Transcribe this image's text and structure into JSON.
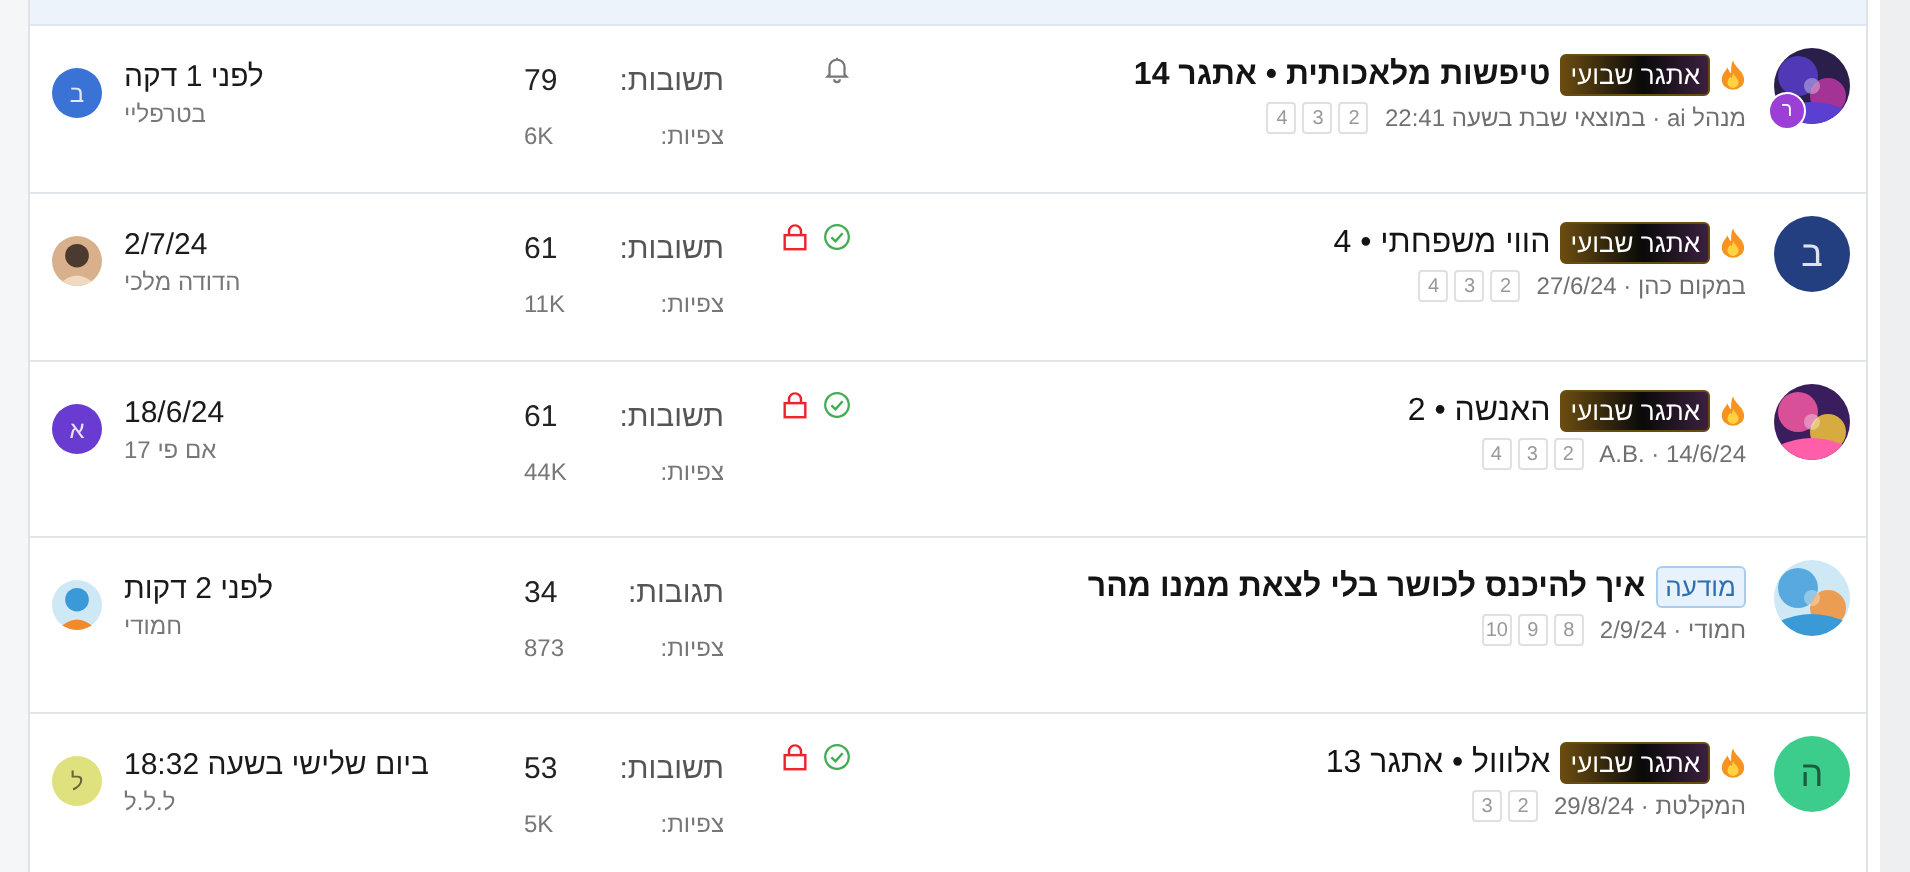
{
  "threads": [
    {
      "avatar": {
        "kind": "picture",
        "badge": "ר"
      },
      "hot": true,
      "tag": {
        "kind": "challenge",
        "text": "אתגר שבועי"
      },
      "title": "טיפשות מלאכותית • אתגר 14",
      "unread": true,
      "meta": "מנהל ai · במוצאי שבת בשעה 22:41",
      "pages": [
        "2",
        "3",
        "4"
      ],
      "watched": true,
      "solved": false,
      "locked": false,
      "replies_label": "תשובות:",
      "replies": "79",
      "views_label": "צפיות:",
      "views": "6K",
      "last": {
        "avatar": {
          "kind": "letter",
          "letter": "ב",
          "color": "#3a72d6"
        },
        "time": "לפני 1 דקה",
        "user": "בטרפליי"
      }
    },
    {
      "avatar": {
        "kind": "letter",
        "letter": "ב",
        "color": "#243f7f"
      },
      "hot": true,
      "tag": {
        "kind": "challenge",
        "text": "אתגר שבועי"
      },
      "title": "הווי משפחתי • 4",
      "unread": false,
      "meta": "במקום כהן · 27/6/24",
      "pages": [
        "2",
        "3",
        "4"
      ],
      "watched": false,
      "solved": true,
      "locked": true,
      "replies_label": "תשובות:",
      "replies": "61",
      "views_label": "צפיות:",
      "views": "11K",
      "last": {
        "time": "2/7/24",
        "user": "הדודה מלכי"
      }
    },
    {
      "hot": true,
      "tag": {
        "kind": "challenge",
        "text": "אתגר שבועי"
      },
      "title": "האנשה • 2",
      "unread": false,
      "meta": "A.B. · 14/6/24",
      "pages": [
        "2",
        "3",
        "4"
      ],
      "watched": false,
      "solved": true,
      "locked": true,
      "replies_label": "תשובות:",
      "replies": "61",
      "views_label": "צפיות:",
      "views": "44K",
      "last": {
        "avatar": {
          "kind": "letter",
          "letter": "א",
          "color": "#6a3bd0"
        },
        "time": "18/6/24",
        "user": "אם פי 17"
      }
    },
    {
      "hot": false,
      "tag": {
        "kind": "notice",
        "text": "מודעה"
      },
      "title": "איך להיכנס לכושר בלי לצאת ממנו מהר",
      "unread": true,
      "meta": "חמודי · 2/9/24",
      "pages": [
        "8",
        "9",
        "10"
      ],
      "watched": false,
      "solved": false,
      "locked": false,
      "replies_label": "תגובות:",
      "replies": "34",
      "views_label": "צפיות:",
      "views": "873",
      "last": {
        "time": "לפני 2 דקות",
        "user": "חמודי"
      }
    },
    {
      "avatar": {
        "kind": "letter",
        "letter": "ה",
        "color": "#3ccd8c"
      },
      "hot": true,
      "tag": {
        "kind": "challenge",
        "text": "אתגר שבועי"
      },
      "title": "אלווול • אתגר 13",
      "unread": false,
      "meta": "המקלטת · 29/8/24",
      "pages": [
        "2",
        "3"
      ],
      "watched": false,
      "solved": true,
      "locked": true,
      "replies_label": "תשובות:",
      "replies": "53",
      "views_label": "צפיות:",
      "views": "5K",
      "last": {
        "avatar": {
          "kind": "letter",
          "letter": "ל",
          "color": "#dfe07e"
        },
        "time": "ביום שלישי בשעה 18:32",
        "user": "ל.ל.ל"
      }
    }
  ]
}
